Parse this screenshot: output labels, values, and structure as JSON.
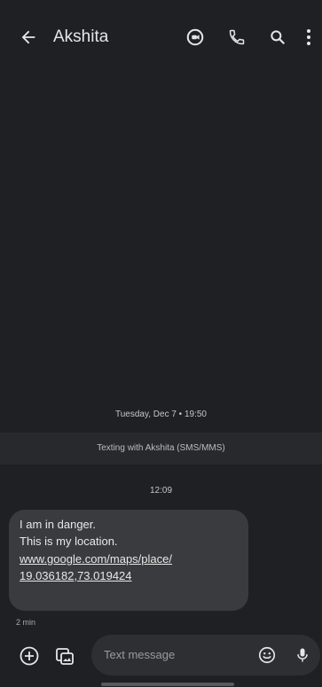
{
  "header": {
    "contact_name": "Akshita",
    "icons": [
      "back-arrow-icon",
      "video-call-icon",
      "phone-icon",
      "search-icon",
      "more-vert-icon"
    ]
  },
  "conversation": {
    "date_stamp": "Tuesday, Dec 7 • 19:50",
    "banner": "Texting with Akshita (SMS/MMS)",
    "time_stamp": "12:09",
    "message": {
      "line1": "I am in danger.",
      "line2": "This is my location.",
      "link_line1": "www.google.com/maps/place/",
      "link_line2": "19.036182,73.019424",
      "age": "2 min"
    }
  },
  "composer": {
    "placeholder": "Text message",
    "icons": [
      "add-icon",
      "gallery-icon",
      "emoji-icon",
      "mic-icon"
    ]
  },
  "colors": {
    "background": "#1f2023",
    "bubble": "#3a3b3f",
    "composer": "#2e2f33"
  }
}
